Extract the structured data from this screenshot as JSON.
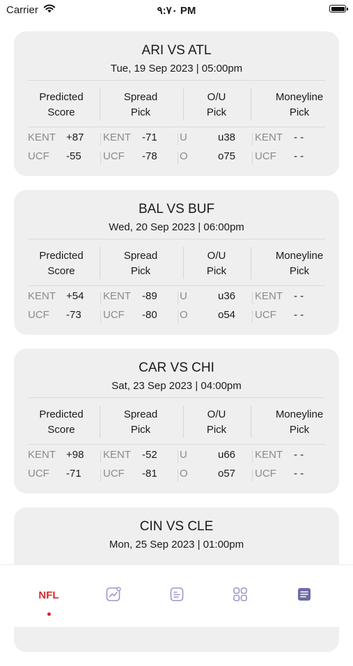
{
  "status_bar": {
    "carrier": "Carrier",
    "time": "۹:۷۰ PM"
  },
  "headers": {
    "predicted": [
      "Predicted",
      "Score"
    ],
    "spread": [
      "Spread",
      "Pick"
    ],
    "ou": [
      "O/U",
      "Pick"
    ],
    "moneyline": [
      "Moneyline",
      "Pick"
    ]
  },
  "games": [
    {
      "matchup": "ARI VS ATL",
      "datetime": "Tue, 19 Sep 2023 | 05:00pm",
      "rows": [
        {
          "team": "KENT",
          "score": "+87",
          "spread_team": "KENT",
          "spread": "-71",
          "ou_side": "U",
          "ou": "u38",
          "ml_team": "KENT",
          "ml": "- -"
        },
        {
          "team": "UCF",
          "score": "-55",
          "spread_team": "UCF",
          "spread": "-78",
          "ou_side": "O",
          "ou": "o75",
          "ml_team": "UCF",
          "ml": "- -"
        }
      ]
    },
    {
      "matchup": "BAL VS BUF",
      "datetime": "Wed, 20 Sep 2023 | 06:00pm",
      "rows": [
        {
          "team": "KENT",
          "score": "+54",
          "spread_team": "KENT",
          "spread": "-89",
          "ou_side": "U",
          "ou": "u36",
          "ml_team": "KENT",
          "ml": "- -"
        },
        {
          "team": "UCF",
          "score": "-73",
          "spread_team": "UCF",
          "spread": "-80",
          "ou_side": "O",
          "ou": "o54",
          "ml_team": "UCF",
          "ml": "- -"
        }
      ]
    },
    {
      "matchup": "CAR VS CHI",
      "datetime": "Sat, 23 Sep 2023 | 04:00pm",
      "rows": [
        {
          "team": "KENT",
          "score": "+98",
          "spread_team": "KENT",
          "spread": "-52",
          "ou_side": "U",
          "ou": "u66",
          "ml_team": "KENT",
          "ml": "- -"
        },
        {
          "team": "UCF",
          "score": "-71",
          "spread_team": "UCF",
          "spread": "-81",
          "ou_side": "O",
          "ou": "o57",
          "ml_team": "UCF",
          "ml": "- -"
        }
      ]
    },
    {
      "matchup": "CIN VS CLE",
      "datetime": "Mon, 25 Sep 2023 | 01:00pm",
      "rows": []
    }
  ],
  "tab_bar": {
    "active_tab": "NFL",
    "tabs": [
      {
        "label": "NFL",
        "icon": "nfl-text"
      },
      {
        "label": "",
        "icon": "trending-chart-icon"
      },
      {
        "label": "",
        "icon": "document-icon"
      },
      {
        "label": "",
        "icon": "grid-icon"
      },
      {
        "label": "",
        "icon": "notes-icon"
      }
    ],
    "colors": {
      "active": "#d9262c",
      "icon": "#9a96c6",
      "icon_filled": "#6c6aa8"
    }
  }
}
